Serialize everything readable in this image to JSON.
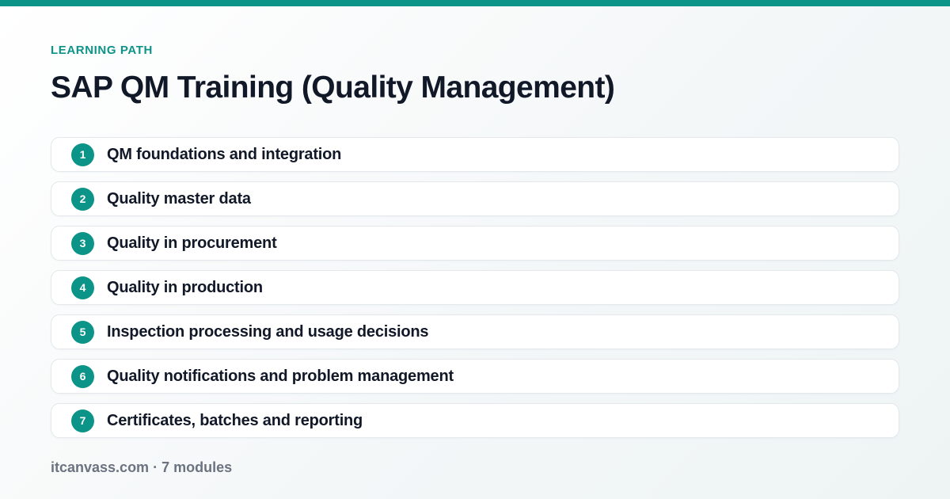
{
  "header": {
    "eyebrow": "LEARNING PATH",
    "title": "SAP QM Training (Quality Management)"
  },
  "modules": [
    {
      "number": "1",
      "label": "QM foundations and integration"
    },
    {
      "number": "2",
      "label": "Quality master data"
    },
    {
      "number": "3",
      "label": "Quality in procurement"
    },
    {
      "number": "4",
      "label": "Quality in production"
    },
    {
      "number": "5",
      "label": "Inspection processing and usage decisions"
    },
    {
      "number": "6",
      "label": "Quality notifications and problem management"
    },
    {
      "number": "7",
      "label": "Certificates, batches and reporting"
    }
  ],
  "footer": {
    "text": "itcanvass.com · 7 modules"
  },
  "colors": {
    "accent": "#0d9488",
    "title": "#111827",
    "muted": "#6b7280"
  }
}
